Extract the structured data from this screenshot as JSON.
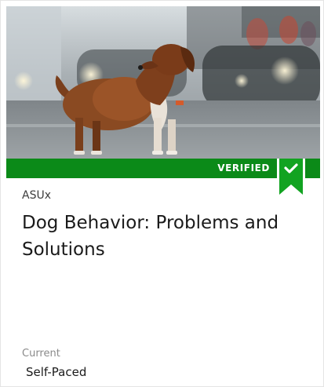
{
  "course": {
    "badge": "VERIFIED",
    "organization": "ASUx",
    "title": "Dog Behavior: Problems and Solutions",
    "status_label": "Current",
    "pacing": "Self-Paced"
  },
  "colors": {
    "badge_green": "#0b8a18",
    "ribbon_green": "#12a321"
  },
  "icons": {
    "verified_ribbon": "bookmark-check-icon"
  }
}
